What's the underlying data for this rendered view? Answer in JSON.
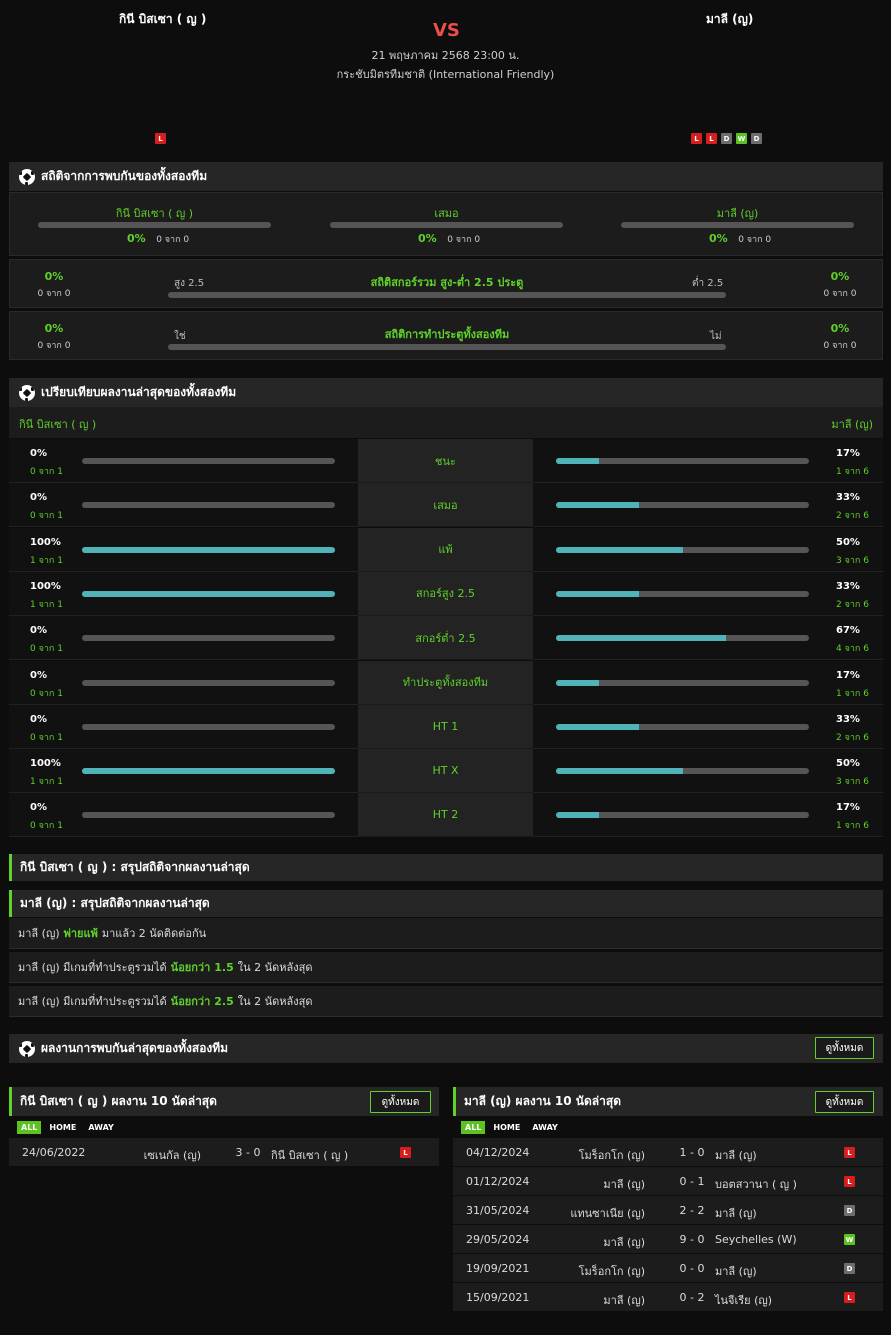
{
  "header": {
    "home_team": "กินี บิสเซา ( ญ )",
    "away_team": "มาลี (ญ)",
    "vs": "VS",
    "date": "21 พฤษภาคม 2568 23:00 น.",
    "competition": "กระชับมิตรทีมชาติ (International Friendly)",
    "home_form": [
      "L"
    ],
    "away_form": [
      "L",
      "L",
      "D",
      "W",
      "D"
    ]
  },
  "h2h": {
    "title": "สถิติจากการพบกันของทั้งสองทีม",
    "cols": [
      {
        "label": "กินี บิสเซา ( ญ )",
        "pct": "0%",
        "count": "0 จาก 0"
      },
      {
        "label": "เสมอ",
        "pct": "0%",
        "count": "0 จาก 0"
      },
      {
        "label": "มาลี (ญ)",
        "pct": "0%",
        "count": "0 จาก 0"
      }
    ],
    "over_under": {
      "title": "สถิติสกอร์รวม สูง-ต่ำ 2.5 ประตู",
      "left_label": "สูง 2.5",
      "right_label": "ต่ำ 2.5",
      "left_pct": "0%",
      "left_count": "0 จาก 0",
      "right_pct": "0%",
      "right_count": "0 จาก 0"
    },
    "btts": {
      "title": "สถิติการทำประตูทั้งสองทีม",
      "left_label": "ใช่",
      "right_label": "ไม่",
      "left_pct": "0%",
      "left_count": "0 จาก 0",
      "right_pct": "0%",
      "right_count": "0 จาก 0"
    }
  },
  "compare": {
    "title": "เปรียบเทียบผลงานล่าสุดของทั้งสองทีม",
    "home_team": "กินี บิสเซา ( ญ )",
    "away_team": "มาลี (ญ)",
    "rows": [
      {
        "label": "ชนะ",
        "home_pct": "0%",
        "home_cnt": "0 จาก 1",
        "home_val": 0,
        "away_pct": "17%",
        "away_cnt": "1 จาก 6",
        "away_val": 0.17
      },
      {
        "label": "เสมอ",
        "home_pct": "0%",
        "home_cnt": "0 จาก 1",
        "home_val": 0,
        "away_pct": "33%",
        "away_cnt": "2 จาก 6",
        "away_val": 0.33
      },
      {
        "label": "แพ้",
        "home_pct": "100%",
        "home_cnt": "1 จาก 1",
        "home_val": 1,
        "away_pct": "50%",
        "away_cnt": "3 จาก 6",
        "away_val": 0.5
      },
      {
        "label": "สกอร์สูง 2.5",
        "home_pct": "100%",
        "home_cnt": "1 จาก 1",
        "home_val": 1,
        "away_pct": "33%",
        "away_cnt": "2 จาก 6",
        "away_val": 0.33
      },
      {
        "label": "สกอร์ต่ำ 2.5",
        "home_pct": "0%",
        "home_cnt": "0 จาก 1",
        "home_val": 0,
        "away_pct": "67%",
        "away_cnt": "4 จาก 6",
        "away_val": 0.67
      },
      {
        "label": "ทำประตูทั้งสองทีม",
        "home_pct": "0%",
        "home_cnt": "0 จาก 1",
        "home_val": 0,
        "away_pct": "17%",
        "away_cnt": "1 จาก 6",
        "away_val": 0.17
      },
      {
        "label": "HT 1",
        "home_pct": "0%",
        "home_cnt": "0 จาก 1",
        "home_val": 0,
        "away_pct": "33%",
        "away_cnt": "2 จาก 6",
        "away_val": 0.33
      },
      {
        "label": "HT X",
        "home_pct": "100%",
        "home_cnt": "1 จาก 1",
        "home_val": 1,
        "away_pct": "50%",
        "away_cnt": "3 จาก 6",
        "away_val": 0.5
      },
      {
        "label": "HT 2",
        "home_pct": "0%",
        "home_cnt": "0 จาก 1",
        "home_val": 0,
        "away_pct": "17%",
        "away_cnt": "1 จาก 6",
        "away_val": 0.17
      }
    ]
  },
  "summary": {
    "home_title": "กินี บิสเซา ( ญ ) : สรุปสถิติจากผลงานล่าสุด",
    "away_title": "มาลี (ญ) : สรุปสถิติจากผลงานล่าสุด",
    "lines": [
      {
        "a": "มาลี (ญ)",
        "b": "พ่ายแพ้",
        "c": "มาแล้ว 2 นัดติดต่อกัน",
        "d": "",
        "e": ""
      },
      {
        "a": "มาลี (ญ)  มีเกมที่ทำประตูรวมได้",
        "b": "น้อยกว่า",
        "c": "1.5",
        "d": "ใน 2 นัดหลังสุด",
        "e": ""
      },
      {
        "a": "มาลี (ญ)  มีเกมที่ทำประตูรวมได้",
        "b": "น้อยกว่า",
        "c": "2.5",
        "d": "ใน 2 นัดหลังสุด",
        "e": ""
      }
    ]
  },
  "recent_h2h": {
    "title": "ผลงานการพบกันล่าสุดของทั้งสองทีม",
    "view_all": "ดูทั้งหมด"
  },
  "home_last10": {
    "title": "กินี บิสเซา ( ญ ) ผลงาน 10 นัดล่าสุด",
    "view_all": "ดูทั้งหมด",
    "tabs": [
      "ALL",
      "HOME",
      "AWAY"
    ],
    "matches": [
      {
        "date": "24/06/2022",
        "home": "เซเนกัล (ญ)",
        "score": "3 - 0",
        "away": "กินี บิสเซา ( ญ )",
        "result": "L"
      }
    ]
  },
  "away_last10": {
    "title": "มาลี (ญ) ผลงาน 10 นัดล่าสุด",
    "view_all": "ดูทั้งหมด",
    "tabs": [
      "ALL",
      "HOME",
      "AWAY"
    ],
    "matches": [
      {
        "date": "04/12/2024",
        "home": "โมร็อกโก (ญ)",
        "score": "1 - 0",
        "away": "มาลี (ญ)",
        "result": "L"
      },
      {
        "date": "01/12/2024",
        "home": "มาลี (ญ)",
        "score": "0 - 1",
        "away": "บอตสวานา ( ญ )",
        "result": "L"
      },
      {
        "date": "31/05/2024",
        "home": "แทนซาเนีย (ญ)",
        "score": "2 - 2",
        "away": "มาลี (ญ)",
        "result": "D"
      },
      {
        "date": "29/05/2024",
        "home": "มาลี (ญ)",
        "score": "9 - 0",
        "away": "Seychelles (W)",
        "result": "W"
      },
      {
        "date": "19/09/2021",
        "home": "โมร็อกโก (ญ)",
        "score": "0 - 0",
        "away": "มาลี (ญ)",
        "result": "D"
      },
      {
        "date": "15/09/2021",
        "home": "มาลี (ญ)",
        "score": "0 - 2",
        "away": "ไนจีเรีย (ญ)",
        "result": "L"
      }
    ]
  }
}
